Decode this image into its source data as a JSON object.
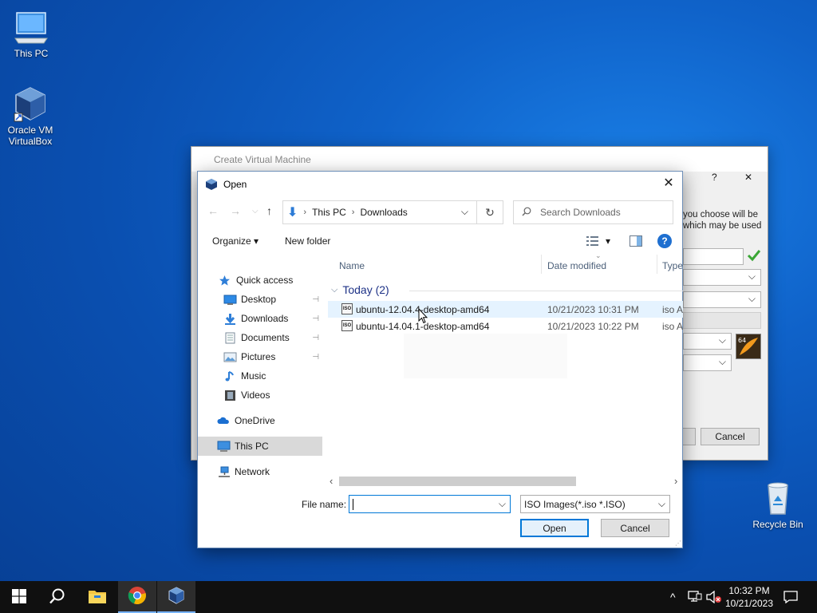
{
  "desktop": {
    "icons": [
      {
        "label": "This PC",
        "icon": "monitor-icon"
      },
      {
        "label": "Oracle VM\nVirtualBox",
        "icon": "virtualbox-icon"
      },
      {
        "label": "Recycle Bin",
        "icon": "recycle-bin-icon"
      }
    ]
  },
  "vbox_dialog": {
    "title": "Create Virtual Machine",
    "help": "?",
    "close": "✕",
    "side_text": "you choose will be\nwhich may be used",
    "cancel_label": "Cancel"
  },
  "open_dialog": {
    "title": "Open",
    "close": "✕",
    "nav": {
      "back": "←",
      "forward": "→",
      "recent": "⌵",
      "up": "↑"
    },
    "address": {
      "crumbs": [
        "This PC",
        "Downloads"
      ],
      "separator": "›",
      "dropdown": "⌵"
    },
    "refresh": "↻",
    "search": {
      "placeholder": "Search Downloads"
    },
    "toolbar": {
      "organize": "Organize ▾",
      "new_folder": "New folder",
      "view": "▾",
      "help": "?"
    },
    "nav_pane": {
      "items": [
        {
          "label": "Quick access",
          "icon": "star-icon",
          "pinned": false
        },
        {
          "label": "Desktop",
          "icon": "desktop-folder-icon",
          "pinned": true
        },
        {
          "label": "Downloads",
          "icon": "download-arrow-icon",
          "pinned": true
        },
        {
          "label": "Documents",
          "icon": "documents-icon",
          "pinned": true
        },
        {
          "label": "Pictures",
          "icon": "pictures-icon",
          "pinned": true
        },
        {
          "label": "Music",
          "icon": "music-note-icon",
          "pinned": false
        },
        {
          "label": "Videos",
          "icon": "film-icon",
          "pinned": false
        },
        {
          "label": "OneDrive",
          "icon": "cloud-icon",
          "pinned": false
        },
        {
          "label": "This PC",
          "icon": "computer-icon",
          "pinned": false
        },
        {
          "label": "Network",
          "icon": "network-icon",
          "pinned": false
        }
      ],
      "pin_glyph": "📌"
    },
    "columns": {
      "name": "Name",
      "date": "Date modified",
      "type": "Type"
    },
    "group": {
      "label": "Today (2)",
      "chevron": "⌵"
    },
    "files": [
      {
        "name": "ubuntu-12.04.4-desktop-amd64",
        "date": "10/21/2023 10:31 PM",
        "type": "iso A",
        "icon_text": "ISO"
      },
      {
        "name": "ubuntu-14.04.1-desktop-amd64",
        "date": "10/21/2023 10:22 PM",
        "type": "iso A",
        "icon_text": "ISO"
      }
    ],
    "scroll": {
      "left": "‹",
      "right": "›"
    },
    "file_name_label": "File name:",
    "file_name_value": "",
    "filter": "ISO Images(*.iso *.ISO)",
    "open_label": "Open",
    "cancel_label": "Cancel"
  },
  "taskbar": {
    "apps": [
      "windows-start-icon",
      "search-icon",
      "file-explorer-icon",
      "chrome-icon",
      "virtualbox-icon"
    ],
    "tray": {
      "chevron": "^",
      "time": "10:32 PM",
      "date": "10/21/2023"
    }
  },
  "colors": {
    "accent": "#0078d7",
    "desktop": "#0f62c9",
    "taskbar": "#101010"
  }
}
